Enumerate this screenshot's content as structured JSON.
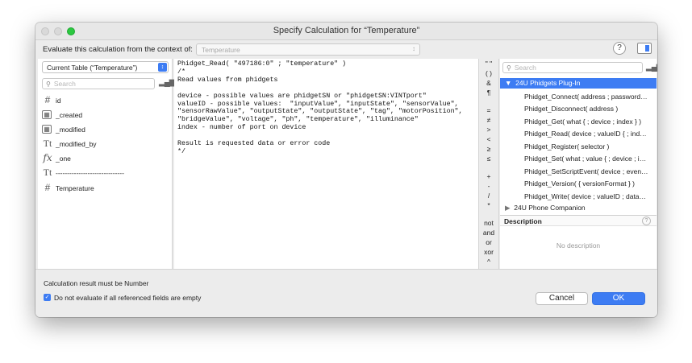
{
  "window": {
    "title": "Specify Calculation for “Temperature”"
  },
  "context": {
    "label": "Evaluate this calculation from the context of:",
    "value": "Temperature",
    "help_label": "?"
  },
  "left": {
    "table_select": "Current Table (“Temperature”)",
    "search_placeholder": "Search",
    "fields": [
      {
        "name": "id",
        "icon": "number-icon",
        "glyph": "#"
      },
      {
        "name": "_created",
        "icon": "calendar-icon",
        "glyph": "▦"
      },
      {
        "name": "_modified",
        "icon": "calendar-icon",
        "glyph": "▦"
      },
      {
        "name": "_modified_by",
        "icon": "text-icon",
        "glyph": "Tt"
      },
      {
        "name": "_one",
        "icon": "function-icon",
        "glyph": "fx"
      },
      {
        "name": "------------------------------",
        "icon": "text-icon",
        "glyph": "Tt"
      },
      {
        "name": "Temperature",
        "icon": "number-icon",
        "glyph": "#"
      }
    ]
  },
  "editor": {
    "lines": [
      "Phidget_Read( \"497186:0\" ; \"temperature\" )",
      "/*",
      "Read values from phidgets",
      "",
      "device - possible values are phidgetSN or \"phidgetSN:VINTport\"",
      "valueID - possible values:  \"inputValue\", \"inputState\", \"sensorValue\",",
      "\"sensorRawValue\", \"outputState\", \"outputState\", \"tag\", \"motorPosition\",",
      "\"bridgeValue\", \"voltage\", \"ph\", \"temperature\", \"illuminance\"",
      "index - number of port on device",
      "",
      "Result is requested data or error code",
      "*/"
    ]
  },
  "operators": [
    "\" \"",
    "( )",
    "&",
    "¶",
    "=",
    "≠",
    ">",
    "<",
    "≥",
    "≤",
    "+",
    "-",
    "/",
    "*",
    "not",
    "and",
    "or",
    "xor",
    "^"
  ],
  "functions": {
    "search_placeholder": "Search",
    "category": "24U Phidgets Plug-In",
    "items": [
      "Phidget_Connect( address ; password…",
      "Phidget_Disconnect( address )",
      "Phidget_Get( what { ; device ; index } )",
      "Phidget_Read( device ; valueID { ; ind…",
      "Phidget_Register( selector )",
      "Phidget_Set( what ; value { ; device ; i…",
      "Phidget_SetScriptEvent( device ; even…",
      "Phidget_Version( { versionFormat } )",
      "Phidget_Write( device ; valueID ; data…"
    ],
    "category2": "24U Phone Companion"
  },
  "description": {
    "title": "Description",
    "empty_text": "No description"
  },
  "bottom": {
    "result_text": "Calculation result must be  Number",
    "checkbox_label": "Do not evaluate if all referenced fields are empty",
    "cancel_label": "Cancel",
    "ok_label": "OK"
  },
  "colors": {
    "accent": "#3d7cf3",
    "window_bg": "#ececec"
  }
}
